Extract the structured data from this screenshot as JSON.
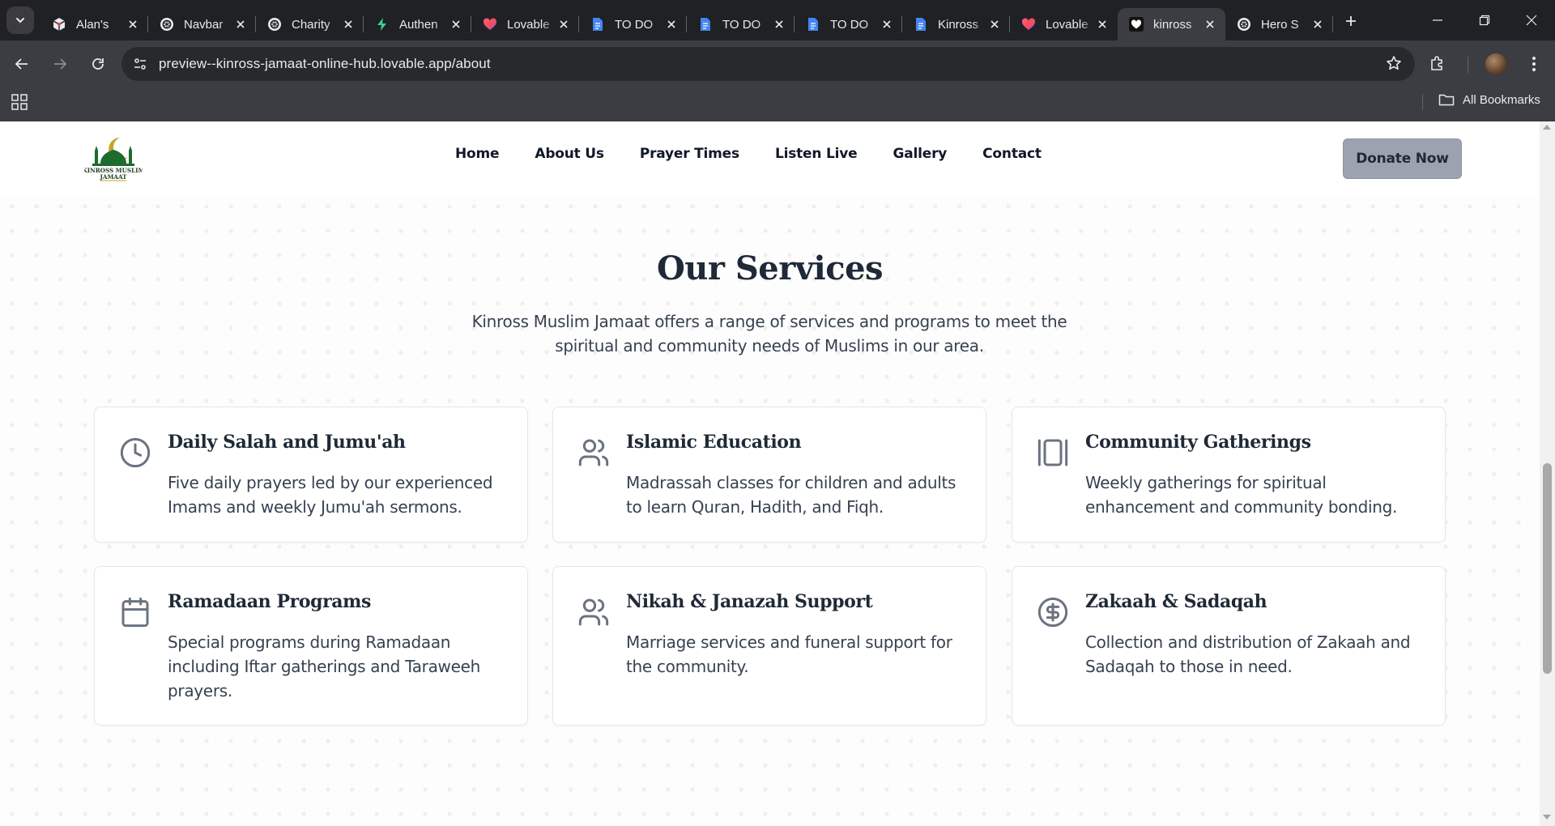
{
  "browser": {
    "tabs": [
      {
        "title": "Alan's",
        "icon": "cube-icon"
      },
      {
        "title": "Navbar",
        "icon": "chatgpt-icon"
      },
      {
        "title": "Charity",
        "icon": "chatgpt-icon"
      },
      {
        "title": "Authen",
        "icon": "bolt-icon"
      },
      {
        "title": "Lovable",
        "icon": "lovable-icon"
      },
      {
        "title": "TO DO",
        "icon": "docs-icon"
      },
      {
        "title": "TO DO",
        "icon": "docs-icon"
      },
      {
        "title": "TO DO",
        "icon": "docs-icon"
      },
      {
        "title": "Kinross",
        "icon": "docs-icon"
      },
      {
        "title": "Lovable",
        "icon": "lovable-icon"
      },
      {
        "title": "kinross",
        "icon": "heart-icon"
      },
      {
        "title": "Hero S",
        "icon": "chatgpt-icon"
      }
    ],
    "active_tab_index": 10,
    "url": "preview--kinross-jamaat-online-hub.lovable.app/about",
    "bookmarks_label": "All Bookmarks"
  },
  "site": {
    "logo_alt": "Kinross Muslim Jamaat",
    "logo_text_line1": "KINROSS MUSLIM",
    "logo_text_line2": "JAMAAT",
    "nav": [
      "Home",
      "About Us",
      "Prayer Times",
      "Listen Live",
      "Gallery",
      "Contact"
    ],
    "donate_label": "Donate Now",
    "colors": {
      "logo_green": "#1f6b2e",
      "logo_gold": "#c9a227",
      "donate_bg": "#9ca3af"
    }
  },
  "services": {
    "title": "Our Services",
    "intro": "Kinross Muslim Jamaat offers a range of services and programs to meet the spiritual and community needs of Muslims in our area.",
    "items": [
      {
        "title": "Daily Salah and Jumu'ah",
        "description": "Five daily prayers led by our experienced Imams and weekly Jumu'ah sermons.",
        "icon": "clock-icon"
      },
      {
        "title": "Islamic Education",
        "description": "Madrassah classes for children and adults to learn Quran, Hadith, and Fiqh.",
        "icon": "users-icon"
      },
      {
        "title": "Community Gatherings",
        "description": "Weekly gatherings for spiritual enhancement and community bonding.",
        "icon": "gallery-vertical-icon"
      },
      {
        "title": "Ramadaan Programs",
        "description": "Special programs during Ramadaan including Iftar gatherings and Taraweeh prayers.",
        "icon": "calendar-icon"
      },
      {
        "title": "Nikah & Janazah Support",
        "description": "Marriage services and funeral support for the community.",
        "icon": "users-icon"
      },
      {
        "title": "Zakaah & Sadaqah",
        "description": "Collection and distribution of Zakaah and Sadaqah to those in need.",
        "icon": "dollar-circle-icon"
      }
    ]
  }
}
